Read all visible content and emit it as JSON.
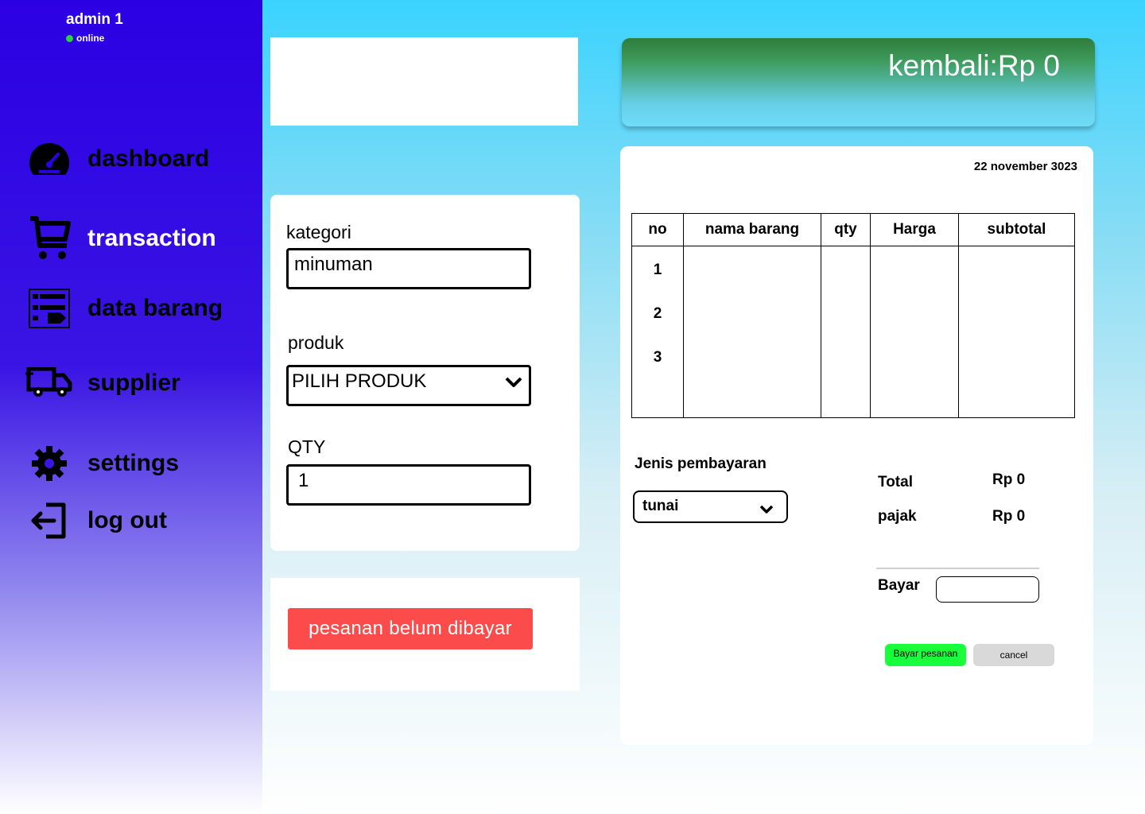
{
  "user": {
    "name": "admin 1",
    "status": "online"
  },
  "nav": [
    {
      "label": "dashboard",
      "icon": "dashboard-icon",
      "active": false
    },
    {
      "label": "transaction",
      "icon": "cart-icon",
      "active": true
    },
    {
      "label": "data barang",
      "icon": "inventory-icon",
      "active": false
    },
    {
      "label": "supplier",
      "icon": "truck-icon",
      "active": false
    },
    {
      "label": "settings",
      "icon": "gear-icon",
      "active": false
    },
    {
      "label": "log out",
      "icon": "logout-icon",
      "active": false
    }
  ],
  "form": {
    "kategori_label": "kategori",
    "kategori_value": "minuman",
    "produk_label": "produk",
    "produk_value": "PILIH PRODUK",
    "qty_label": "QTY",
    "qty_value": "1"
  },
  "unpaid_button": "pesanan belum dibayar",
  "change": "kembali:Rp 0",
  "receipt": {
    "date": "22 november 3023",
    "columns": [
      "no",
      "nama barang",
      "qty",
      "Harga",
      "subtotal"
    ],
    "rows": [
      "1",
      "2",
      "3"
    ],
    "payment_label": "Jenis pembayaran",
    "payment_value": "tunai",
    "total_label": "Total",
    "total_value": "Rp 0",
    "tax_label": "pajak",
    "tax_value": "Rp 0",
    "pay_label": "Bayar",
    "pay_button": "Bayar pesanan",
    "cancel_button": "cancel"
  },
  "colors": {
    "sidebar": "#2b00e3",
    "unpaid_button": "#fb4b4b",
    "pay_button": "#19ff3c",
    "cancel_button": "#d9d9d9",
    "online_dot": "#28d33c"
  }
}
